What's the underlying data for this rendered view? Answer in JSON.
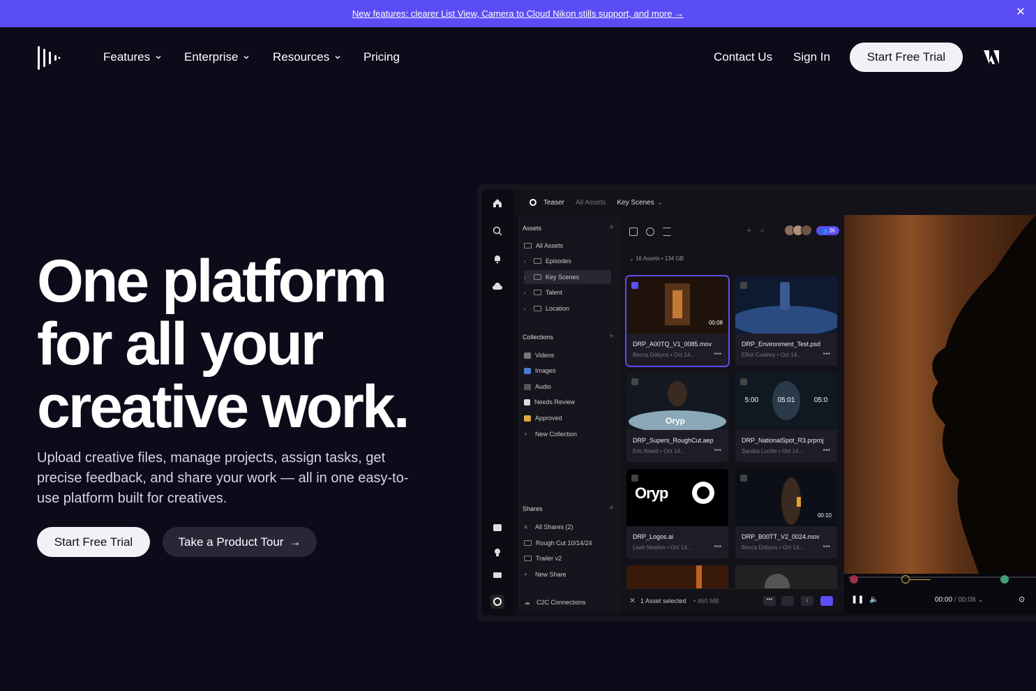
{
  "banner": {
    "text": "New features: clearer List View, Camera to Cloud Nikon stills support, and more →",
    "close_icon": "close-icon"
  },
  "nav": {
    "items": [
      {
        "label": "Features",
        "has_dropdown": true
      },
      {
        "label": "Enterprise",
        "has_dropdown": true
      },
      {
        "label": "Resources",
        "has_dropdown": true
      },
      {
        "label": "Pricing",
        "has_dropdown": false
      }
    ],
    "contact": "Contact Us",
    "signin": "Sign In",
    "cta": "Start Free Trial"
  },
  "hero": {
    "title_lines": [
      "One platform",
      "for all your",
      "creative work."
    ],
    "subtitle": "Upload creative files, manage projects, assign tasks, get precise feedback, and share your work — all in one easy-to-use platform built for creatives.",
    "primary_cta": "Start Free Trial",
    "secondary_cta": "Take a Product Tour",
    "secondary_arrow": "→"
  },
  "app": {
    "breadcrumbs": [
      "Teaser",
      "All Assets",
      "Key Scenes"
    ],
    "assets_section": "Assets",
    "assets_items": [
      "All Assets",
      "Episodes",
      "Key Scenes",
      "Talent",
      "Location"
    ],
    "collections_section": "Collections",
    "collections_items": [
      "Videos",
      "Images",
      "Audio",
      "Needs Review",
      "Approved",
      "New Collection"
    ],
    "shares_section": "Shares",
    "shares_items": [
      "All Shares (2)",
      "Rough Cut 10/14/24",
      "Trailer v2",
      "New Share"
    ],
    "c2c": "C2C Connections",
    "assets_count": "16 Assets",
    "assets_size": "134 GB",
    "members_count": "36",
    "cards": [
      {
        "name": "DRP_A00TQ_V1_0085.mov",
        "meta": "Becca Dobyns  •  Oct 14...",
        "duration": "00:08"
      },
      {
        "name": "DRP_Environment_Test.psd",
        "meta": "Elliot Coakley  •  Oct 14...",
        "duration": ""
      },
      {
        "name": "DRP_Supers_RoughCut.aep",
        "meta": "Eric Atwell  •  Oct 14...",
        "duration": ""
      },
      {
        "name": "DRP_NationalSpot_R3.prproj",
        "meta": "Sandra Lucille  •  Oct 14...",
        "duration": ""
      },
      {
        "name": "DRP_Logos.ai",
        "meta": "Leah Newlon  •  Oct 14...",
        "duration": ""
      },
      {
        "name": "DRP_B00TT_V2_0024.mov",
        "meta": "Becca Dobyns  •  Oct 14...",
        "duration": "00:10"
      }
    ],
    "thumb_text": {
      "supers": "Oryp",
      "timeline": [
        "5:00",
        "05:01",
        "05:0"
      ],
      "logo": "Oryp"
    },
    "selection": "1 Asset selected",
    "selection_size": "• 460 MB",
    "timecode_current": "00:00",
    "timecode_total": "/ 00:08"
  },
  "colors": {
    "accent": "#5b4df5",
    "background": "#0d0a1a"
  }
}
